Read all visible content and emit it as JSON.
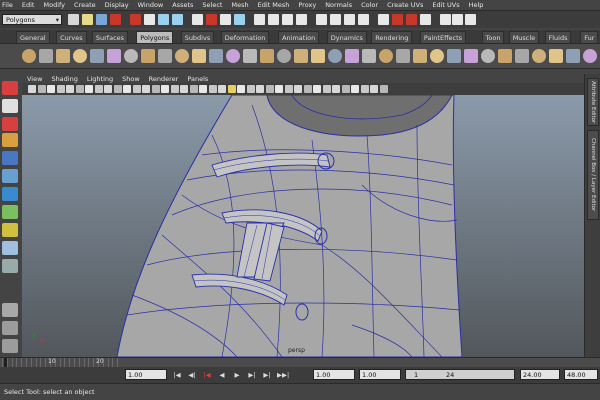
{
  "menubar": [
    "File",
    "Edit",
    "Modify",
    "Create",
    "Display",
    "Window",
    "Assets",
    "Select",
    "Mesh",
    "Edit Mesh",
    "Proxy",
    "Normals",
    "Color",
    "Create UVs",
    "Edit UVs",
    "Help"
  ],
  "statusline": {
    "mode": "Polygons"
  },
  "shelf_tabs": [
    "General",
    "Curves",
    "Surfaces",
    "Polygons",
    "Subdivs",
    "Deformation",
    "Animation",
    "Dynamics",
    "Rendering",
    "PaintEffects",
    "Toon",
    "Muscle",
    "Fluids",
    "Fur"
  ],
  "active_shelf_tab": "Polygons",
  "panel_menu": [
    "View",
    "Shading",
    "Lighting",
    "Show",
    "Renderer",
    "Panels"
  ],
  "viewport": {
    "camera_label": "persp",
    "axis_y": "y",
    "axis_x": "x"
  },
  "right_tabs": {
    "attribute_editor": "Attribute Editor",
    "channel_box": "Channel Box / Layer Editor"
  },
  "timeline": {
    "label_10": "10",
    "label_20": "20"
  },
  "range": {
    "current_time": "1.00",
    "start_time": "1.00",
    "playback_start": "1.00",
    "range_start": "1",
    "range_end": "24",
    "playback_end": "24.00",
    "end_time": "48.00"
  },
  "playback_buttons": [
    "|◀",
    "◀|",
    "|◀",
    "◀",
    "▶",
    "▶|",
    "▶|",
    "▶▶|"
  ],
  "helpline": "Select Tool: select an object",
  "colors": {
    "accent_red": "#c7372a",
    "mesh_wire": "#2b2fa6",
    "mesh_fill": "#a9a9a9"
  }
}
